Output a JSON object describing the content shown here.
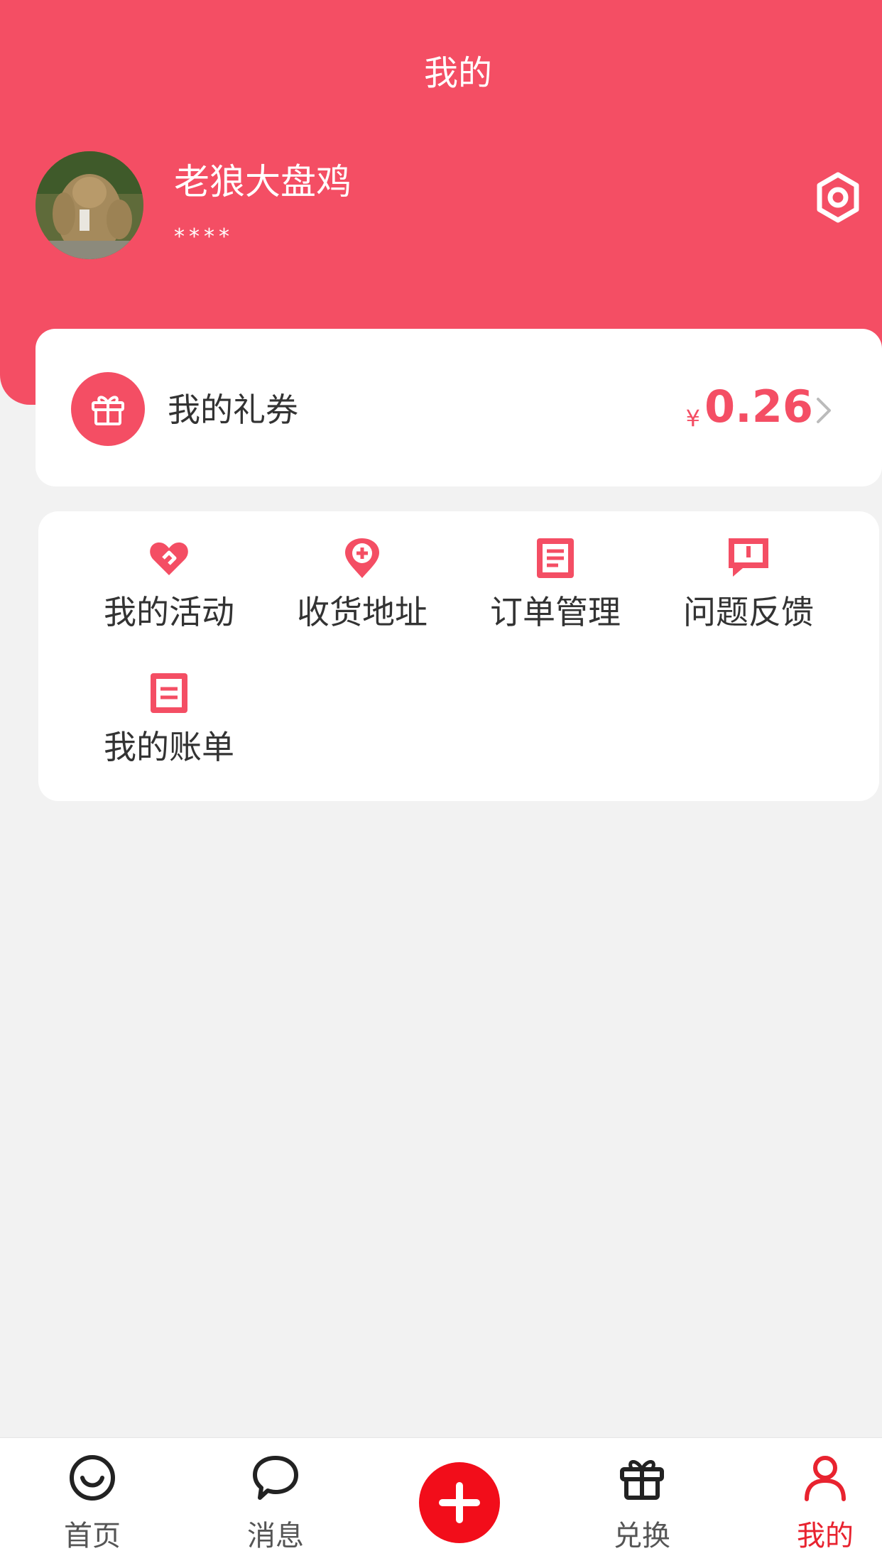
{
  "header": {
    "title": "我的",
    "background_color": "#f44e64"
  },
  "profile": {
    "name": "老狼大盘鸡",
    "phone_masked": "****",
    "avatar_icon": "avatar-photo",
    "settings_icon": "gear-icon"
  },
  "coupon": {
    "label": "我的礼券",
    "currency": "¥",
    "amount": "0.26",
    "icon": "gift-icon",
    "arrow_icon": "chevron-right-icon"
  },
  "menu": {
    "items": [
      {
        "label": "我的活动",
        "icon": "heart-link-icon"
      },
      {
        "label": "收货地址",
        "icon": "location-plus-icon"
      },
      {
        "label": "订单管理",
        "icon": "document-icon"
      },
      {
        "label": "问题反馈",
        "icon": "feedback-icon"
      },
      {
        "label": "我的账单",
        "icon": "bill-icon"
      }
    ]
  },
  "bottom_nav": {
    "items": [
      {
        "label": "首页",
        "icon": "smile-icon"
      },
      {
        "label": "消息",
        "icon": "chat-bubble-icon"
      },
      {
        "label": "",
        "icon": "plus-icon"
      },
      {
        "label": "兑换",
        "icon": "gift-icon"
      },
      {
        "label": "我的",
        "icon": "user-icon",
        "active": true
      }
    ],
    "active_color": "#e8232f"
  }
}
